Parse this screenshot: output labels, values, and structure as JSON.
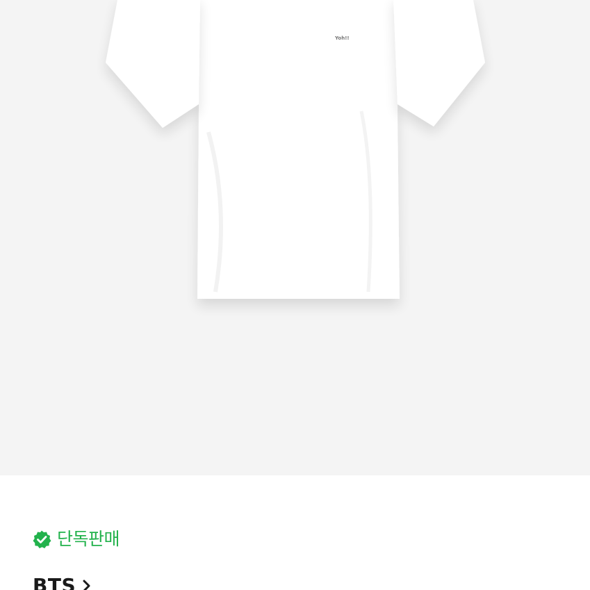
{
  "product": {
    "image_icon": "white-tshirt-image",
    "logo_print": "Yoh!!",
    "background_color": "#f4f4f4"
  },
  "badge": {
    "icon": "verified-check-icon",
    "label": "단독판매",
    "color": "#22b24c"
  },
  "artist": {
    "name": "BTS",
    "chevron_icon": "chevron-right-icon"
  }
}
